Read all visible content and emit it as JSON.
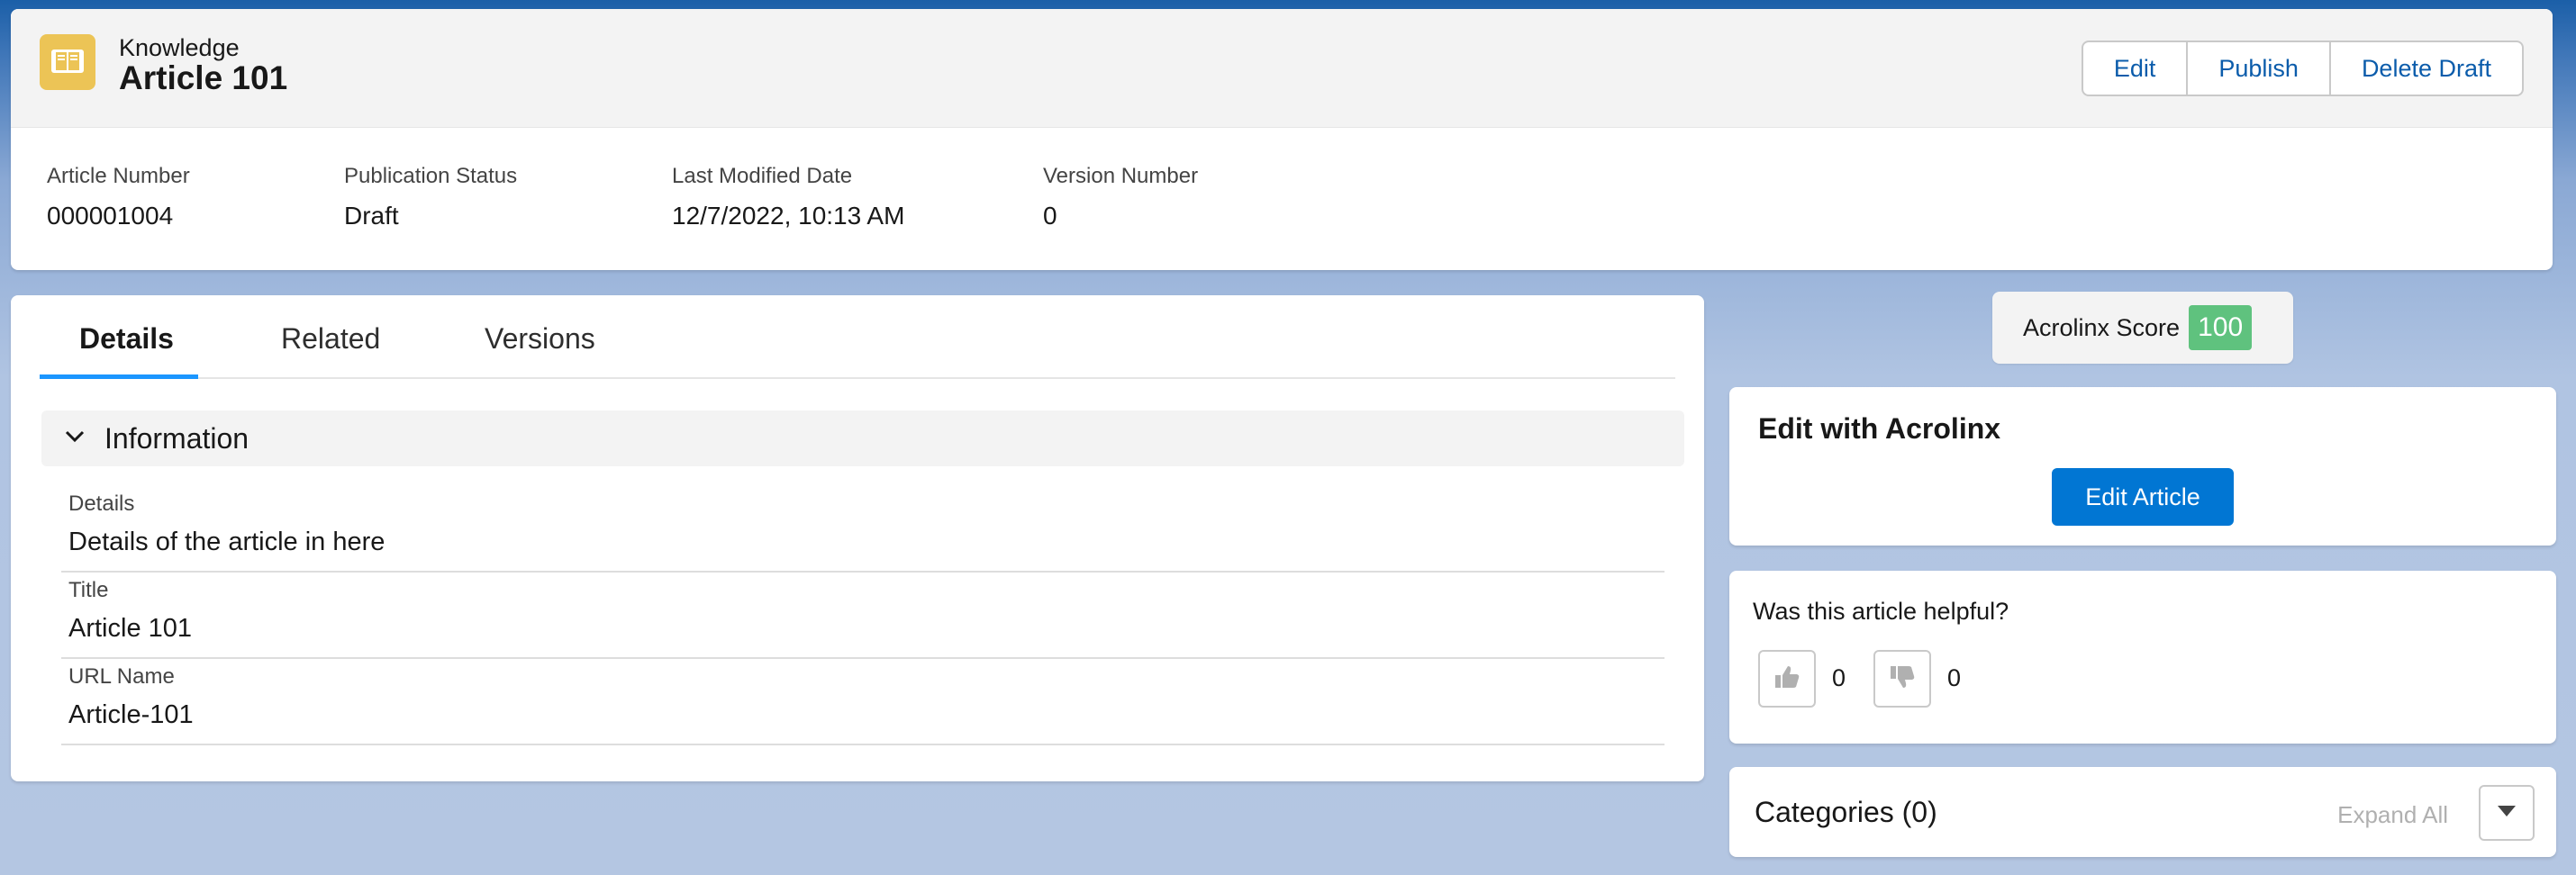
{
  "header": {
    "object_type": "Knowledge",
    "record_name": "Article 101",
    "icon": "knowledge-book-icon",
    "buttons": [
      "Edit",
      "Publish",
      "Delete Draft"
    ],
    "highlights": [
      {
        "label": "Article Number",
        "value": "000001004"
      },
      {
        "label": "Publication Status",
        "value": "Draft"
      },
      {
        "label": "Last Modified Date",
        "value": "12/7/2022, 10:13 AM"
      },
      {
        "label": "Version Number",
        "value": "0"
      }
    ]
  },
  "tabs": [
    {
      "label": "Details",
      "active": true
    },
    {
      "label": "Related",
      "active": false
    },
    {
      "label": "Versions",
      "active": false
    }
  ],
  "section": {
    "title": "Information",
    "icon": "chevron-down-icon",
    "fields": [
      {
        "label": "Details",
        "value": "Details of the article in here"
      },
      {
        "label": "Title",
        "value": "Article 101"
      },
      {
        "label": "URL Name",
        "value": "Article-101"
      }
    ]
  },
  "acrolinx": {
    "score_label": "Acrolinx Score",
    "score_value": "100",
    "card_title": "Edit with Acrolinx",
    "edit_button": "Edit Article"
  },
  "helpful": {
    "question": "Was this article helpful?",
    "up_count": "0",
    "down_count": "0",
    "up_icon": "thumbs-up-icon",
    "down_icon": "thumbs-down-icon"
  },
  "categories": {
    "title": "Categories (0)",
    "expand_label": "Expand All",
    "icon": "caret-down-icon"
  },
  "colors": {
    "brand": "#0176d3",
    "link": "#0b5cab",
    "knowledge_icon": "#ecc456",
    "score_badge": "#5fc27e",
    "tab_active": "#1b96ff"
  }
}
